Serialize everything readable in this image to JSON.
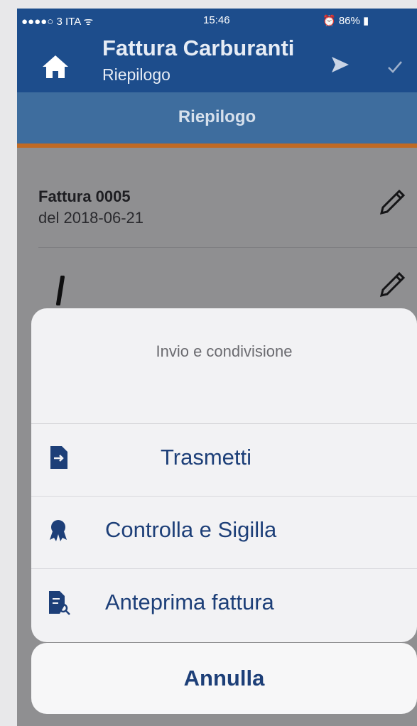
{
  "status_bar": {
    "carrier": "●●●●○ 3 ITA ᯤ",
    "time": "15:46",
    "battery": "⏰ 86% ▮"
  },
  "nav": {
    "title": "Fattura Carburanti",
    "subtitle": "Riepilogo"
  },
  "tab": {
    "label": "Riepilogo"
  },
  "invoice": {
    "title": "Fattura  0005",
    "date": "del  2018-06-21"
  },
  "sheet": {
    "title": "Invio e condivisione",
    "actions": [
      {
        "label": "Trasmetti",
        "icon": "document-send-icon"
      },
      {
        "label": "Controlla e Sigilla",
        "icon": "seal-badge-icon"
      },
      {
        "label": "Anteprima fattura",
        "icon": "document-search-icon"
      }
    ],
    "cancel": "Annulla"
  },
  "colors": {
    "nav": "#1d4d8c",
    "tab": "#3e6d9e",
    "accent": "#c06a24",
    "action_text": "#1d3f78"
  }
}
